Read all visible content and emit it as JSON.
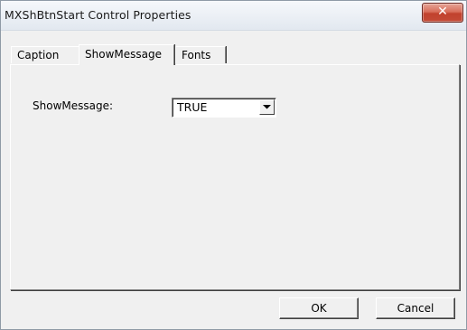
{
  "window": {
    "title": "MXShBtnStart Control Properties",
    "close_symbol": "✕"
  },
  "tabs": [
    {
      "label": "Caption",
      "active": false
    },
    {
      "label": "ShowMessage",
      "active": true
    },
    {
      "label": "Fonts",
      "active": false
    }
  ],
  "panel": {
    "field_label": "ShowMessage:",
    "select_value": "TRUE"
  },
  "buttons": {
    "ok_label": "OK",
    "cancel_label": "Cancel"
  },
  "icons": {
    "close": "close-icon",
    "dropdown": "chevron-down-icon"
  },
  "colors": {
    "dialog_bg": "#f0f0f0",
    "close_button": "#c44a36"
  }
}
